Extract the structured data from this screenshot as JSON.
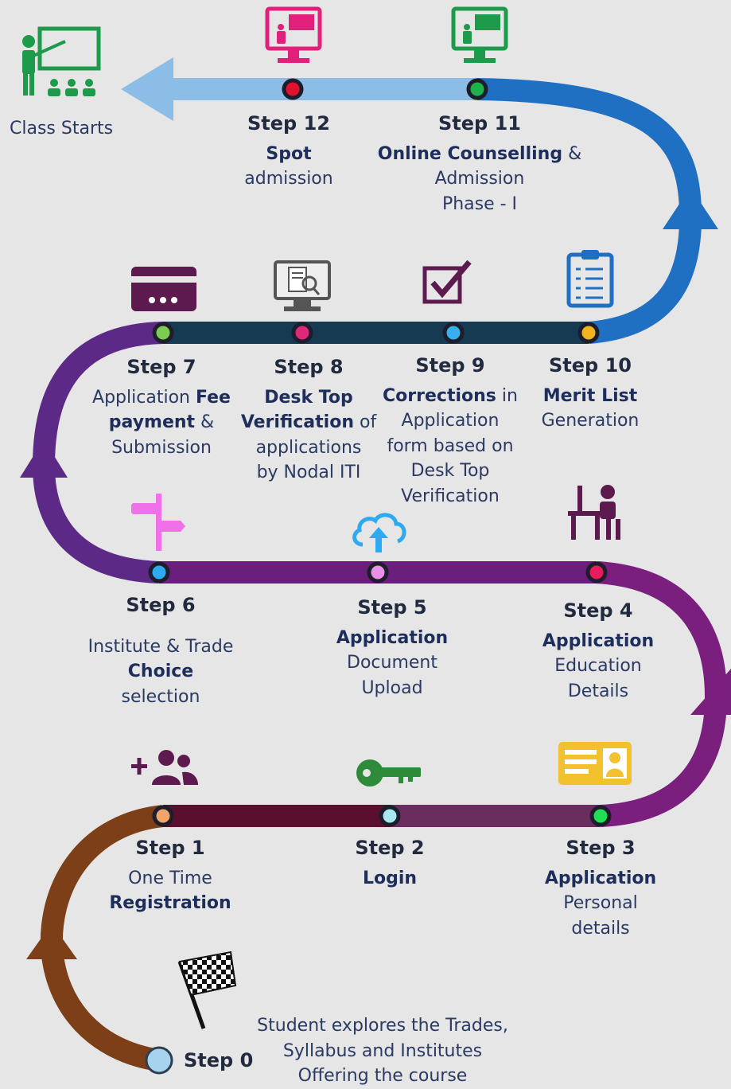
{
  "end_label": "Class Starts",
  "steps": [
    {
      "id": "step0",
      "title": "Step 0",
      "lines": [
        [
          {
            "t": "Student explores the Trades,",
            "b": false
          }
        ],
        [
          {
            "t": "Syllabus and Institutes",
            "b": false
          }
        ],
        [
          {
            "t": "Offering the course",
            "b": false
          }
        ]
      ],
      "icon": "checkered-flag-icon"
    },
    {
      "id": "step1",
      "title": "Step 1",
      "lines": [
        [
          {
            "t": "One Time",
            "b": false
          }
        ],
        [
          {
            "t": "Registration",
            "b": true
          }
        ]
      ],
      "icon": "add-user-icon"
    },
    {
      "id": "step2",
      "title": "Step 2",
      "lines": [
        [
          {
            "t": "Login",
            "b": true
          }
        ]
      ],
      "icon": "key-icon"
    },
    {
      "id": "step3",
      "title": "Step 3",
      "lines": [
        [
          {
            "t": "Application",
            "b": true
          }
        ],
        [
          {
            "t": "Personal",
            "b": false
          }
        ],
        [
          {
            "t": "details",
            "b": false
          }
        ]
      ],
      "icon": "id-card-icon"
    },
    {
      "id": "step4",
      "title": "Step 4",
      "lines": [
        [
          {
            "t": "Application",
            "b": true
          }
        ],
        [
          {
            "t": "Education",
            "b": false
          }
        ],
        [
          {
            "t": "Details",
            "b": false
          }
        ]
      ],
      "icon": "student-desk-icon"
    },
    {
      "id": "step5",
      "title": "Step 5",
      "lines": [
        [
          {
            "t": "Application",
            "b": true
          }
        ],
        [
          {
            "t": "Document",
            "b": false
          }
        ],
        [
          {
            "t": "Upload",
            "b": false
          }
        ]
      ],
      "icon": "cloud-upload-icon"
    },
    {
      "id": "step6",
      "title": "Step 6",
      "lines": [
        [
          {
            "t": "Institute & Trade",
            "b": false
          }
        ],
        [
          {
            "t": "Choice",
            "b": true
          }
        ],
        [
          {
            "t": "selection",
            "b": false
          }
        ]
      ],
      "icon": "signpost-icon"
    },
    {
      "id": "step7",
      "title": "Step 7",
      "lines": [
        [
          {
            "t": "Application ",
            "b": false
          },
          {
            "t": "Fee",
            "b": true
          }
        ],
        [
          {
            "t": "payment",
            "b": true
          },
          {
            "t": " &",
            "b": false
          }
        ],
        [
          {
            "t": "Submission",
            "b": false
          }
        ]
      ],
      "icon": "credit-card-icon"
    },
    {
      "id": "step8",
      "title": "Step 8",
      "lines": [
        [
          {
            "t": "Desk Top",
            "b": true
          }
        ],
        [
          {
            "t": "Verification",
            "b": true
          },
          {
            "t": " of",
            "b": false
          }
        ],
        [
          {
            "t": "applications",
            "b": false
          }
        ],
        [
          {
            "t": "by Nodal ITI",
            "b": false
          }
        ]
      ],
      "icon": "desktop-verification-icon"
    },
    {
      "id": "step9",
      "title": "Step 9",
      "lines": [
        [
          {
            "t": "Corrections",
            "b": true
          },
          {
            "t": " in",
            "b": false
          }
        ],
        [
          {
            "t": "Application",
            "b": false
          }
        ],
        [
          {
            "t": "form based on",
            "b": false
          }
        ],
        [
          {
            "t": "Desk Top",
            "b": false
          }
        ],
        [
          {
            "t": "Verification",
            "b": false
          }
        ]
      ],
      "icon": "checkbox-icon"
    },
    {
      "id": "step10",
      "title": "Step 10",
      "lines": [
        [
          {
            "t": "Merit List",
            "b": true
          }
        ],
        [
          {
            "t": "Generation",
            "b": false
          }
        ]
      ],
      "icon": "clipboard-list-icon"
    },
    {
      "id": "step11",
      "title": "Step 11",
      "lines": [
        [
          {
            "t": "Online Counselling",
            "b": true
          },
          {
            "t": " &",
            "b": false
          }
        ],
        [
          {
            "t": "Admission",
            "b": false
          }
        ],
        [
          {
            "t": "Phase - I",
            "b": false
          }
        ]
      ],
      "icon": "monitor-presentation-icon"
    },
    {
      "id": "step12",
      "title": "Step 12",
      "lines": [
        [
          {
            "t": "Spot",
            "b": true
          }
        ],
        [
          {
            "t": "admission",
            "b": false
          }
        ]
      ],
      "icon": "monitor-presentation-icon"
    }
  ],
  "colors": {
    "segment_0_1": "#7c3f18",
    "segment_1_2": "#5a0f2e",
    "segment_2_3": "#6b2d5d",
    "segment_3_4": "#7a1f7e",
    "segment_4_6": "#6a1f7c",
    "segment_6_7": "#5c2a86",
    "segment_7_10": "#153a52",
    "segment_10_11": "#1f6fc2",
    "segment_11_end": "#8bbde6",
    "dot_step0": "#a8d3ee",
    "dot_step1": "#f2a46a",
    "dot_step2": "#a8e8f2",
    "dot_step3": "#1fe052",
    "dot_step4": "#e81c5c",
    "dot_step5": "#e890e6",
    "dot_step6": "#2eaaf0",
    "dot_step7": "#7ecb52",
    "dot_step8": "#e0287a",
    "dot_step9": "#39b0ee",
    "dot_step10": "#f2b51c",
    "dot_step11": "#1fb24a",
    "dot_step12": "#e0102e"
  }
}
